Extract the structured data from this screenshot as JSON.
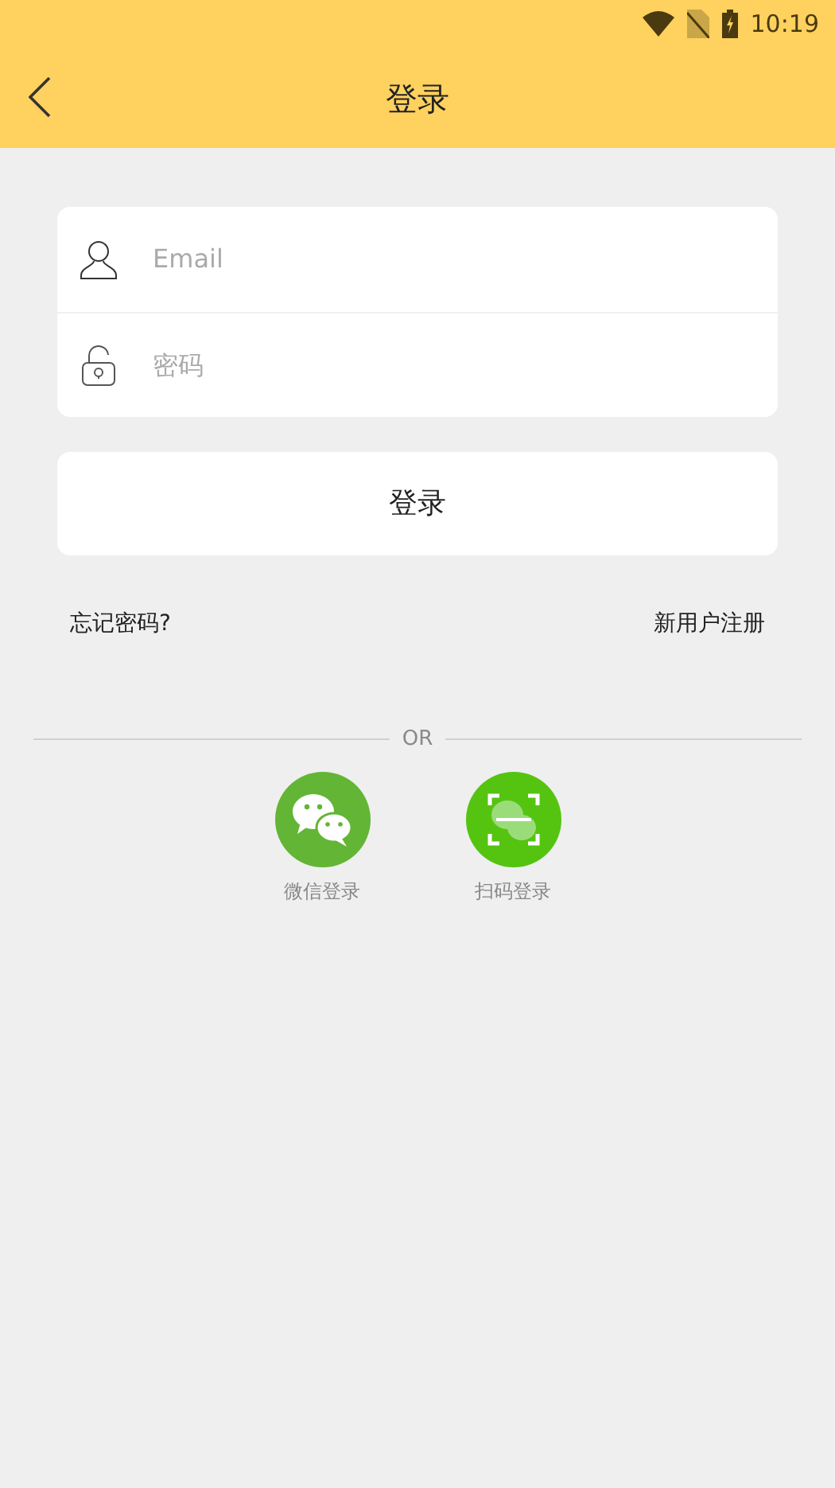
{
  "status_bar": {
    "time": "10:19"
  },
  "header": {
    "title": "登录"
  },
  "form": {
    "fields": [
      {
        "kind": "user",
        "placeholder": "Email"
      },
      {
        "kind": "lock",
        "placeholder": "密码"
      }
    ],
    "submit": "登录"
  },
  "links": {
    "forgot": "忘记密码?",
    "register": "新用户注册"
  },
  "divider": "OR",
  "social": [
    {
      "kind": "wechat",
      "label": "微信登录"
    },
    {
      "kind": "scan",
      "label": "扫码登录"
    }
  ]
}
